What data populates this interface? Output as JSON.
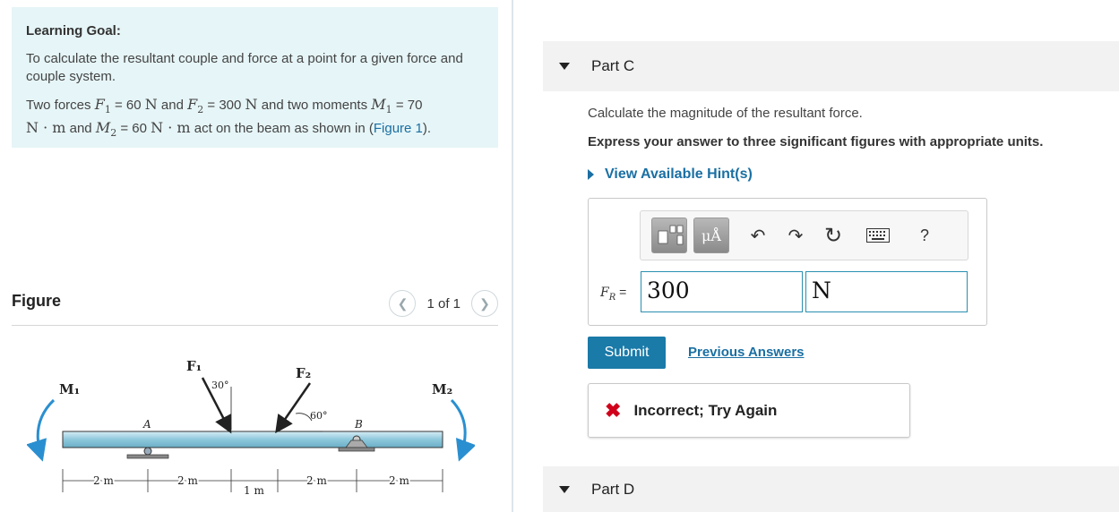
{
  "learning_goal": {
    "title": "Learning Goal:",
    "p1": "To calculate the resultant couple and force at a point for a given force and couple system.",
    "p2_text1": "Two forces ",
    "F1": "F",
    "F1_sub": "1",
    "eq1": " = 60 ",
    "unit_N": "N",
    "and": " and ",
    "F2": "F",
    "F2_sub": "2",
    "eq2": " = 300 ",
    "text_two_moments": " and two moments ",
    "M1": "M",
    "M1_sub": "1",
    "eq3": " = 70",
    "unit_Nm": "N · m",
    "and2": " and ",
    "M2": "M",
    "M2_sub": "2",
    "eq4": " = 60 ",
    "text_act": " act on the beam as shown in (",
    "figure_link": "Figure 1",
    "close": ")."
  },
  "figure": {
    "title": "Figure",
    "pager": "1 of 1",
    "labels": {
      "m1": "M₁",
      "m2": "M₂",
      "f1": "F₁",
      "f2": "F₂",
      "a30": "30°",
      "a60": "60°",
      "A": "A",
      "B": "B",
      "d1": "2 m",
      "d2": "2 m",
      "d3": "1 m",
      "d4": "2 m",
      "d5": "2 m"
    }
  },
  "part_c": {
    "label": "Part C",
    "question": "Calculate the magnitude of the resultant force.",
    "instruction": "Express your answer to three significant figures with appropriate units.",
    "hint": "View Available Hint(s)",
    "toolbar": {
      "units_btn": "μÅ",
      "help": "?"
    },
    "fr_symbol": "F",
    "fr_sub": "R",
    "fr_eq": " =",
    "value": "300",
    "unit": "N",
    "submit": "Submit",
    "previous": "Previous Answers",
    "feedback": "Incorrect; Try Again"
  },
  "part_d": {
    "label": "Part D"
  }
}
